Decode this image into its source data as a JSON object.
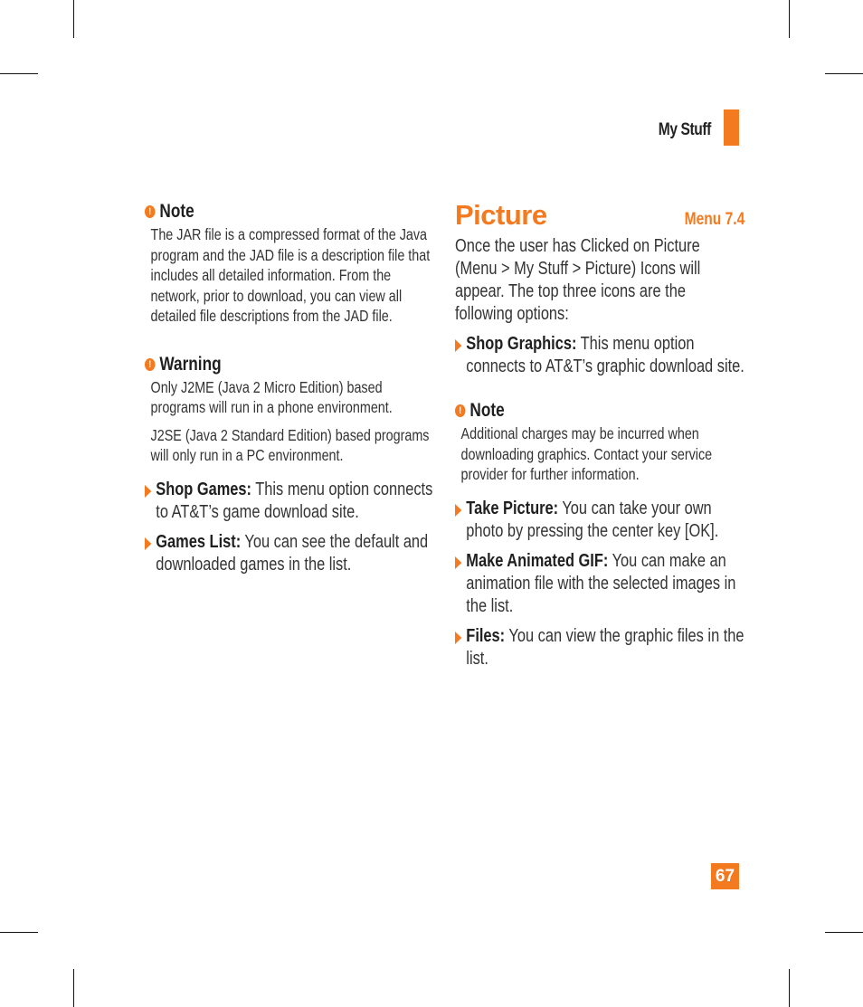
{
  "header": {
    "section_label": "My Stuff",
    "accent_color": "#f37a1f"
  },
  "left_column": {
    "note": {
      "icon": "alert-icon",
      "title": "Note",
      "body": "The JAR file is a compressed format of the Java program and the JAD file is a description file that includes all detailed information. From the network, prior to download, you can view all detailed file descriptions from the JAD file."
    },
    "warning": {
      "icon": "alert-icon",
      "title": "Warning",
      "paragraphs": [
        "Only J2ME (Java 2 Micro Edition) based programs will run in a phone environment.",
        "J2SE (Java 2 Standard Edition) based programs will only run in a PC environment."
      ]
    },
    "bullets": [
      {
        "label": "Shop Games:",
        "text": " This menu option connects to AT&T’s game download site."
      },
      {
        "label": "Games List:",
        "text": " You can see the default and downloaded games in the list."
      }
    ]
  },
  "right_column": {
    "title": "Picture",
    "menu_ref": "Menu 7.4",
    "intro": "Once the user has Clicked on Picture (Menu > My Stuff > Picture) Icons will appear. The top three icons are the following options:",
    "bullets_before_note": [
      {
        "label": "Shop Graphics:",
        "text": " This menu option connects to AT&T’s graphic download site."
      }
    ],
    "note": {
      "icon": "alert-icon",
      "title": "Note",
      "body": "Additional charges may be incurred when downloading graphics. Contact your service provider for further information."
    },
    "bullets_after_note": [
      {
        "label": "Take Picture:",
        "text": " You can take your own photo by pressing the center key [OK]."
      },
      {
        "label": "Make Animated GIF:",
        "text": " You can make an animation file with the selected images in the list."
      },
      {
        "label": "Files:",
        "text": " You can view the graphic files in the list."
      }
    ]
  },
  "footer": {
    "page_number": "67"
  }
}
